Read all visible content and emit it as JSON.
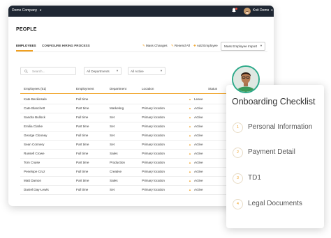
{
  "topbar": {
    "company": "Demo Company",
    "user_name": "Knit Demo"
  },
  "page_title": "PEOPLE",
  "tabs": [
    {
      "label": "EMPLOYEES",
      "active": true
    },
    {
      "label": "CONFIGURE HIRING PROCESS",
      "active": false
    }
  ],
  "actions": {
    "mass_changes": "Mass Changes",
    "resend_all": "Resend All",
    "add_employee": "Add Employee",
    "mass_import": "Mass Employee Import"
  },
  "filters": {
    "search_placeholder": "Search...",
    "departments": "All Departments",
    "status": "All Active"
  },
  "table": {
    "headers": [
      "Employees (51)",
      "Employment",
      "Department",
      "Location",
      "Status"
    ],
    "rows": [
      {
        "name": "Kate Beckinsale",
        "employment": "Full time",
        "department": "",
        "location": "",
        "status": "Leave"
      },
      {
        "name": "Cate Blanchett",
        "employment": "Part time",
        "department": "Marketing",
        "location": "Primary location",
        "status": "Active"
      },
      {
        "name": "Sandra Bullock",
        "employment": "Full time",
        "department": "Set",
        "location": "Primary location",
        "status": "Active"
      },
      {
        "name": "Emilia Clarke",
        "employment": "Part time",
        "department": "Set",
        "location": "Primary location",
        "status": "Active"
      },
      {
        "name": "George Clooney",
        "employment": "Full time",
        "department": "Set",
        "location": "Primary location",
        "status": "Active"
      },
      {
        "name": "Sean Connery",
        "employment": "Part time",
        "department": "Set",
        "location": "Primary location",
        "status": "Active"
      },
      {
        "name": "Russell Crowe",
        "employment": "Full time",
        "department": "Sales",
        "location": "Primary location",
        "status": "Active"
      },
      {
        "name": "Tom Cruise",
        "employment": "Part time",
        "department": "Production",
        "location": "Primary location",
        "status": "Active"
      },
      {
        "name": "Penelope Cruz",
        "employment": "Full time",
        "department": "Creative",
        "location": "Primary location",
        "status": "Active"
      },
      {
        "name": "Matt Damon",
        "employment": "Part time",
        "department": "Sales",
        "location": "Primary location",
        "status": "Active"
      },
      {
        "name": "Daniel Day-Lewis",
        "employment": "Full time",
        "department": "Set",
        "location": "Primary location",
        "status": "Active"
      }
    ]
  },
  "checklist": {
    "title": "Onboarding Checklist",
    "steps": [
      {
        "num": "1",
        "label": "Personal Information"
      },
      {
        "num": "2",
        "label": "Payment Detail"
      },
      {
        "num": "3",
        "label": "TD1"
      },
      {
        "num": "4",
        "label": "Legal Documents"
      }
    ]
  },
  "colors": {
    "accent": "#f0a020",
    "topbar": "#1f2733",
    "avatar_ring": "#2eaa8a"
  }
}
